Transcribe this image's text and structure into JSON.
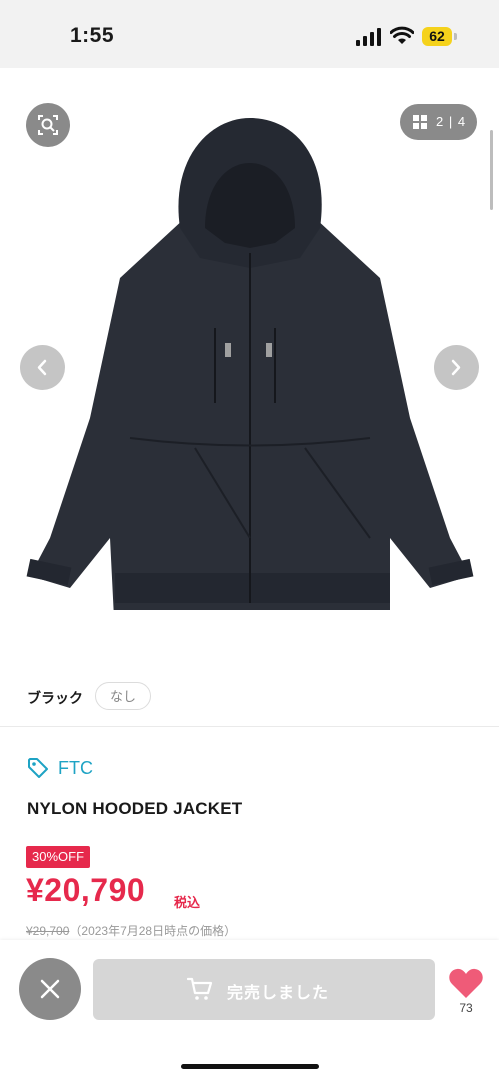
{
  "status_bar": {
    "time": "1:55",
    "battery": "62"
  },
  "gallery": {
    "counter": "2 | 4"
  },
  "variant": {
    "label": "ブラック",
    "option": "なし"
  },
  "product": {
    "brand": "FTC",
    "title": "NYLON HOODED JACKET",
    "discount_badge": "30%OFF",
    "price": "¥20,790",
    "tax_label": "税込",
    "original_price": "¥29,700",
    "original_note": "（2023年7月28日時点の価格）"
  },
  "actions": {
    "soldout_label": "完売しました",
    "like_count": "73"
  },
  "colors": {
    "accent_red": "#e6294c",
    "brand_blue": "#1ea3c4",
    "button_gray": "#d6d6d6"
  },
  "icons": [
    "lens-search-icon",
    "grid-icon",
    "chevron-left-icon",
    "chevron-right-icon",
    "tag-icon",
    "close-icon",
    "cart-icon",
    "heart-icon"
  ]
}
